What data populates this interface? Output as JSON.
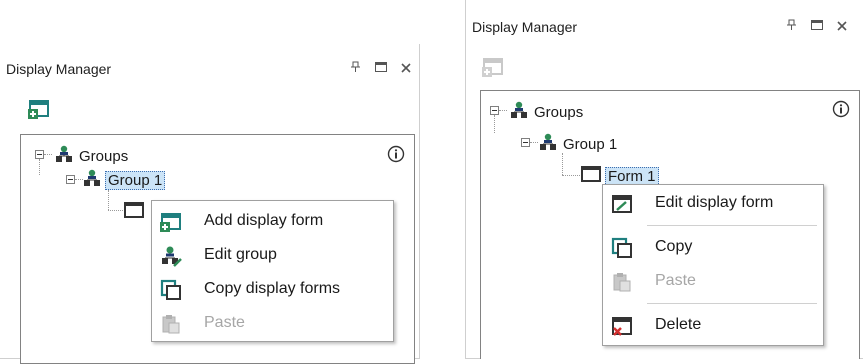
{
  "left": {
    "title": "Display Manager",
    "pin_glyph": "ⲁ",
    "tree": {
      "root_label": "Groups",
      "group_label": "Group 1"
    },
    "menu": [
      {
        "label": "Add display form",
        "icon": "add-display-form-icon",
        "disabled": false
      },
      {
        "label": "Edit group",
        "icon": "edit-group-icon",
        "disabled": false
      },
      {
        "label": "Copy display forms",
        "icon": "copy-icon",
        "disabled": false
      },
      {
        "label": "Paste",
        "icon": "paste-icon",
        "disabled": true
      }
    ]
  },
  "right": {
    "title": "Display Manager",
    "tree": {
      "root_label": "Groups",
      "group_label": "Group 1",
      "form_label": "Form 1"
    },
    "menu": [
      {
        "label": "Edit display form",
        "icon": "edit-display-form-icon",
        "disabled": false
      },
      {
        "label": "Copy",
        "icon": "copy-icon",
        "disabled": false
      },
      {
        "label": "Paste",
        "icon": "paste-icon",
        "disabled": true
      },
      {
        "label": "Delete",
        "icon": "delete-icon",
        "disabled": false
      }
    ]
  },
  "colors": {
    "accent_green": "#2e8b57",
    "accent_teal": "#1f8a8a",
    "selection_bg": "#cce4f7",
    "delete_red": "#d32f2f",
    "disabled_gray": "#a6a6a6"
  }
}
